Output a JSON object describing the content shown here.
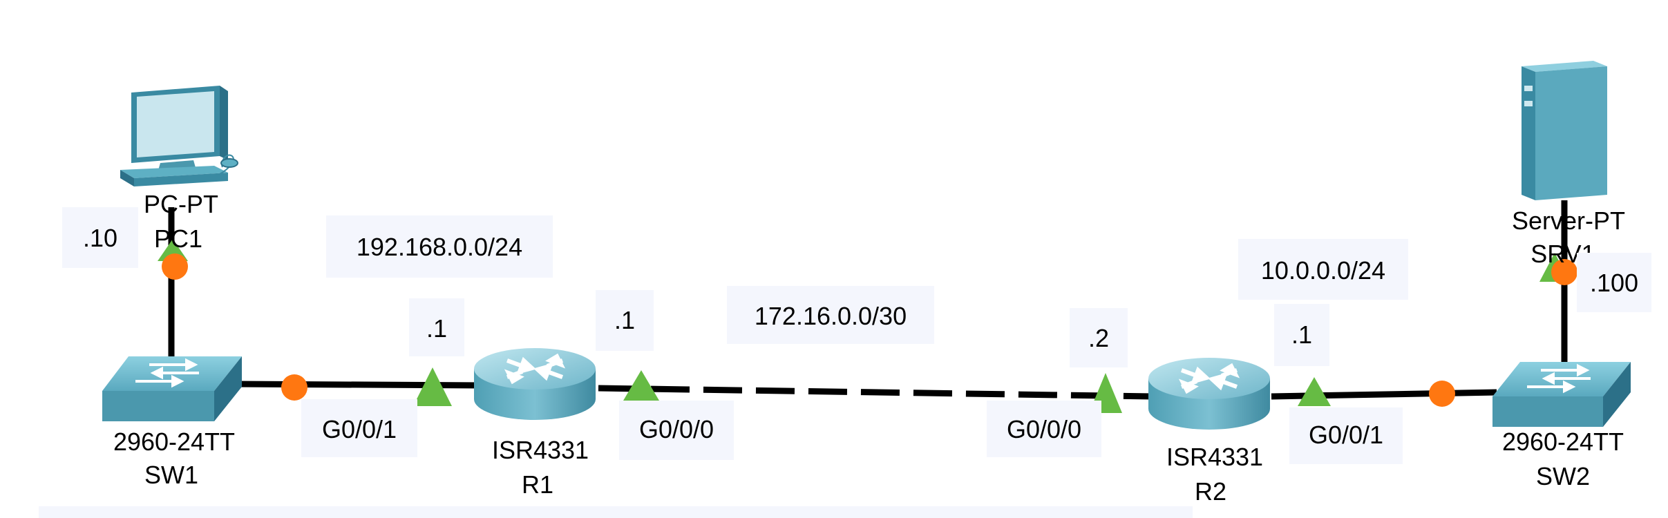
{
  "devices": {
    "pc1": {
      "model": "PC-PT",
      "name": "PC1"
    },
    "sw1": {
      "model": "2960-24TT",
      "name": "SW1"
    },
    "r1": {
      "model": "ISR4331",
      "name": "R1"
    },
    "r2": {
      "model": "ISR4331",
      "name": "R2"
    },
    "sw2": {
      "model": "2960-24TT",
      "name": "SW2"
    },
    "srv1": {
      "model": "Server-PT",
      "name": "SRV1"
    }
  },
  "interfaces": {
    "r1_lan": "G0/0/1",
    "r1_wan": "G0/0/0",
    "r2_wan": "G0/0/0",
    "r2_lan": "G0/0/1"
  },
  "networks": {
    "lan1": "192.168.0.0/24",
    "wan": "172.16.0.0/30",
    "lan2": "10.0.0.0/24"
  },
  "host_addresses": {
    "pc1": ".10",
    "r1_lan": ".1",
    "r1_wan": ".1",
    "r2_wan": ".2",
    "r2_lan": ".1",
    "srv1": ".100"
  },
  "colors": {
    "link_up": "#66bb44",
    "link_orange": "#ff7711",
    "device_blue": "#4b98ad",
    "note_bg": "#f4f6fd"
  }
}
